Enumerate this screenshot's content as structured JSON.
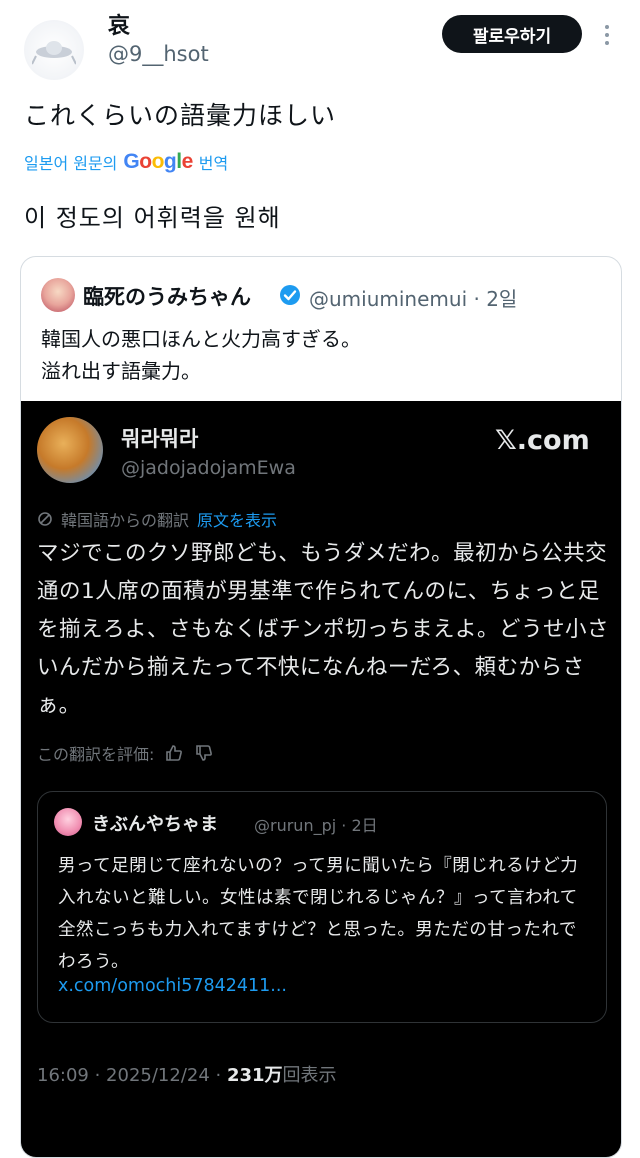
{
  "author": {
    "display_name": "哀",
    "handle": "@9__hsot"
  },
  "follow_button": "팔로우하기",
  "tweet": {
    "text": "これくらいの語彙力ほしい",
    "translate_prefix": "일본어 원문의",
    "translate_brand": "Google",
    "translate_suffix": "번역",
    "translated_text": "이 정도의 어휘력을 원해"
  },
  "quote": {
    "name": "臨死のうみちゃん",
    "meta": "@umiuminemui · 2일",
    "line1": "韓国人の悪口ほんと火力高すぎる。",
    "line2": "溢れ出す語彙力。"
  },
  "screenshot": {
    "name": "뭐라뭐라",
    "handle": "@jadojadojamEwa",
    "brand": "𝕏.com",
    "translation_note": "韓国語からの翻訳",
    "show_original": "原文を表示",
    "body": "マジでこのクソ野郎ども、もうダメだわ。最初から公共交通の1人席の面積が男基準で作られてんのに、ちょっと足を揃えろよ、さもなくばチンポ切っちまえよ。どうせ小さいんだから揃えたって不快になんねーだろ、頼むからさぁ。",
    "rate_label": "この翻訳を評価:",
    "inner": {
      "name": "きぶんやちゃま",
      "meta": "@rurun_pj · 2日",
      "body": "男って足閉じて座れないの？って男に聞いたら『閉じれるけど力入れないと難しい。女性は素で閉じれるじゃん？』って言われて全然こっちも力入れてますけど？と思った。男ただの甘ったれでわろう。",
      "link": "x.com/omochi57842411..."
    },
    "footer_time": "16:09 · 2025/12/24 ·",
    "footer_views": "231万",
    "footer_suffix": "回表示"
  },
  "colors": {
    "link": "#1d9bf0",
    "muted": "#536471",
    "dark_bg": "#000000",
    "verified": "#1d9bf0"
  },
  "icons": [
    "avatar-ufo-icon",
    "more-dots-icon",
    "verified-badge-icon",
    "translate-icon",
    "thumbs-up-icon",
    "thumbs-down-icon"
  ]
}
